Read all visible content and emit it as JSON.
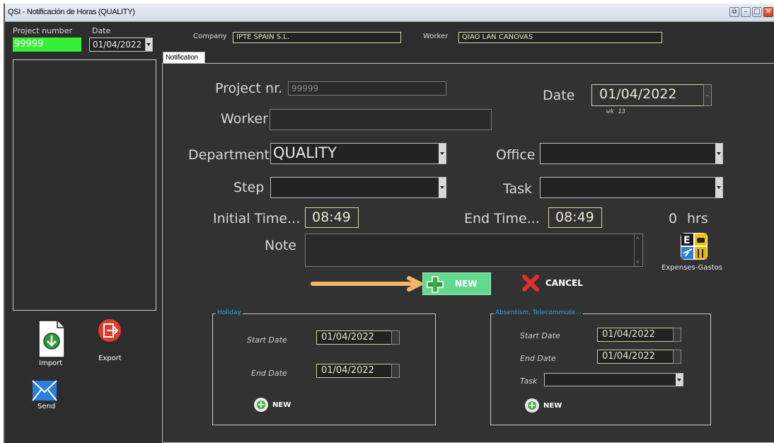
{
  "window": {
    "title": "QSI - Notificación de Horas (QUALITY)",
    "buttons": [
      "restore",
      "minimize",
      "maximize",
      "close"
    ]
  },
  "top": {
    "project_number_label": "Project number",
    "project_number_value": "99999",
    "date_label": "Date",
    "date_value": "01/04/2022",
    "company_label": "Company",
    "company_value": "IPTE SPAIN S.L.",
    "worker_label": "Worker",
    "worker_value": "QIAO LAN CANOVAS"
  },
  "tab": {
    "label": "Notification"
  },
  "form": {
    "project_nr_label": "Project nr.",
    "project_nr_value": "99999",
    "date_label": "Date",
    "date_value": "01/04/2022",
    "week_text": "wk 13",
    "worker_label": "Worker",
    "worker_value": "",
    "department_label": "Department",
    "department_value": "QUALITY",
    "office_label": "Office",
    "office_value": "",
    "step_label": "Step",
    "step_value": "",
    "task_label": "Task",
    "task_value": "",
    "initial_time_label": "Initial Time...",
    "initial_time_value": "08:49",
    "end_time_label": "End Time...",
    "end_time_value": "08:49",
    "hours_value": "0",
    "hours_unit": "hrs",
    "note_label": "Note",
    "note_value": "",
    "new_label": "NEW",
    "cancel_label": "CANCEL",
    "expenses_label": "Expenses-Gastos"
  },
  "holiday": {
    "legend": "Holiday",
    "start_label": "Start Date",
    "start_value": "01/04/2022",
    "end_label": "End Date",
    "end_value": "01/04/2022",
    "new_label": "NEW"
  },
  "absentism": {
    "legend": "Absentism, Telecommute...",
    "start_label": "Start Date",
    "start_value": "01/04/2022",
    "end_label": "End Date",
    "end_value": "01/04/2022",
    "task_label": "Task",
    "task_value": "",
    "new_label": "NEW"
  },
  "sidebar": {
    "import_label": "Import",
    "export_label": "Export",
    "send_label": "Send"
  },
  "colors": {
    "accent_green": "#3cff3c",
    "new_button": "#5ed68a",
    "arrow": "#f2b56b",
    "cancel": "#e03030",
    "legend_blue": "#2aa7e8"
  }
}
